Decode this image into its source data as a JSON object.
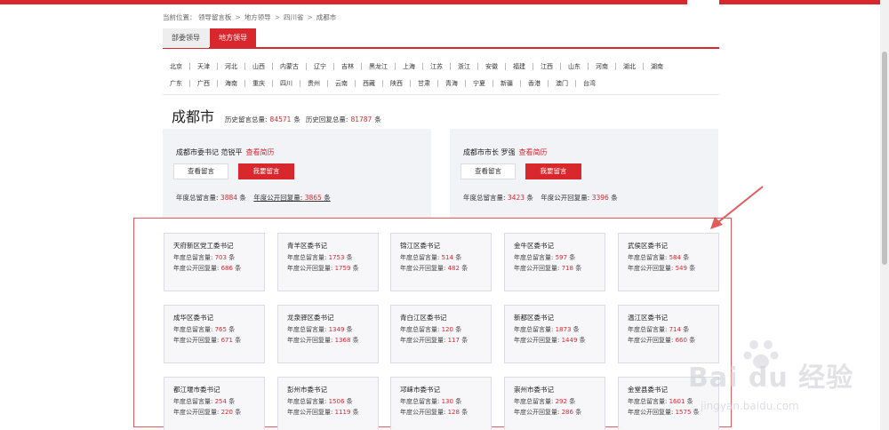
{
  "breadcrumb": {
    "prefix": "当前位置：",
    "items": [
      "领导留言板",
      "地方领导",
      "四川省",
      "成都市"
    ],
    "separator": ">"
  },
  "tabs": [
    {
      "label": "部委领导",
      "active": false
    },
    {
      "label": "地方领导",
      "active": true
    }
  ],
  "provinces": {
    "row1": [
      "北京",
      "天津",
      "河北",
      "山西",
      "内蒙古",
      "辽宁",
      "吉林",
      "黑龙江",
      "上海",
      "江苏",
      "浙江",
      "安徽",
      "福建",
      "江西",
      "山东",
      "河南",
      "湖北",
      "湖南"
    ],
    "row2": [
      "广东",
      "广西",
      "海南",
      "重庆",
      "四川",
      "贵州",
      "云南",
      "西藏",
      "陕西",
      "甘肃",
      "青海",
      "宁夏",
      "新疆",
      "香港",
      "澳门",
      "台湾"
    ]
  },
  "city": {
    "name": "成都市",
    "history_total_label": "历史留言总量:",
    "history_total": "84571",
    "history_reply_label": "历史回复总量:",
    "history_reply": "81787",
    "unit": "条"
  },
  "leaders": [
    {
      "title": "成都市委书记 范锐平",
      "resume": "查看简历",
      "view_label": "查看留言",
      "write_label": "我要留言",
      "year_total_label": "年度总留言量:",
      "year_total": "3884",
      "year_reply_label": "年度公开回复量:",
      "year_reply": "3865",
      "unit": "条"
    },
    {
      "title": "成都市市长 罗强",
      "resume": "查看简历",
      "view_label": "查看留言",
      "write_label": "我要留言",
      "year_total_label": "年度总留言量:",
      "year_total": "3423",
      "year_reply_label": "年度公开回复量:",
      "year_reply": "3396",
      "unit": "条"
    }
  ],
  "districts": {
    "total_label": "年度总留言量:",
    "reply_label": "年度公开回复量:",
    "unit": "条",
    "items": [
      {
        "name": "天府新区党工委书记",
        "total": "703",
        "reply": "686"
      },
      {
        "name": "青羊区委书记",
        "total": "1753",
        "reply": "1759"
      },
      {
        "name": "锦江区委书记",
        "total": "514",
        "reply": "482"
      },
      {
        "name": "金牛区委书记",
        "total": "597",
        "reply": "718"
      },
      {
        "name": "武侯区委书记",
        "total": "584",
        "reply": "549"
      },
      {
        "name": "成华区委书记",
        "total": "765",
        "reply": "671"
      },
      {
        "name": "龙泉驿区委书记",
        "total": "1349",
        "reply": "1368"
      },
      {
        "name": "青白江区委书记",
        "total": "120",
        "reply": "117"
      },
      {
        "name": "新都区委书记",
        "total": "1873",
        "reply": "1449"
      },
      {
        "name": "温江区委书记",
        "total": "714",
        "reply": "660"
      },
      {
        "name": "都江堰市委书记",
        "total": "254",
        "reply": "220"
      },
      {
        "name": "彭州市委书记",
        "total": "1506",
        "reply": "1119"
      },
      {
        "name": "邛崃市委书记",
        "total": "130",
        "reply": "128"
      },
      {
        "name": "崇州市委书记",
        "total": "292",
        "reply": "286"
      },
      {
        "name": "金堂县委书记",
        "total": "1601",
        "reply": "1575"
      }
    ]
  },
  "watermark": {
    "text": "Bai du 经验",
    "url": "jingyan.baidu.com"
  },
  "colors": {
    "brand_red": "#d9272e",
    "annotation_red": "#e35b5b"
  }
}
